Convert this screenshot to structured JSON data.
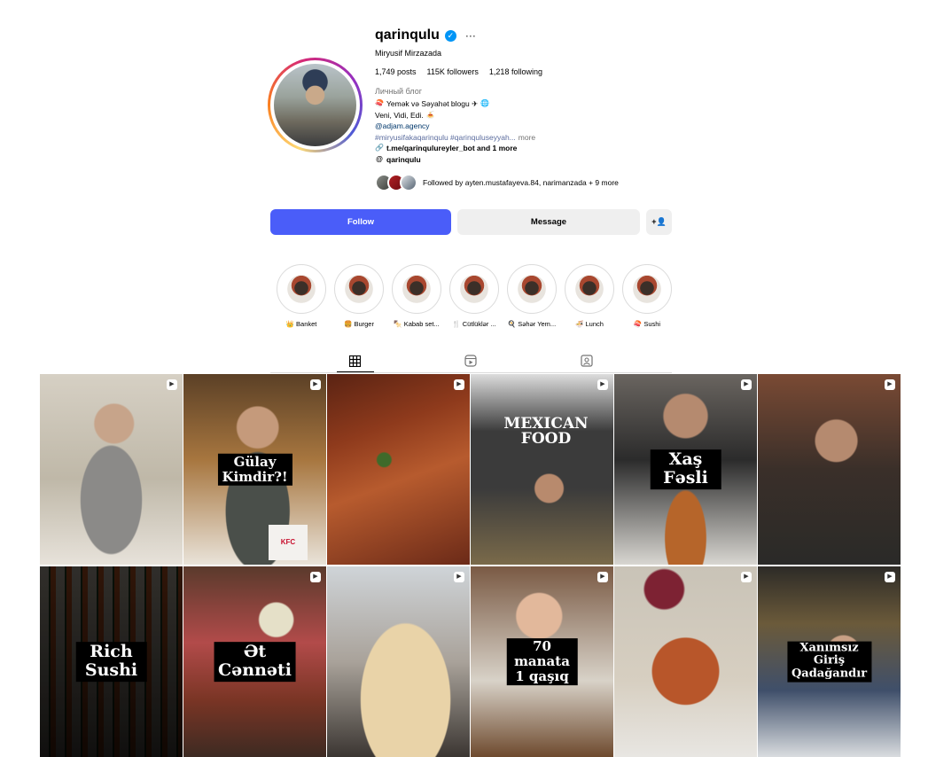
{
  "profile": {
    "username": "qarinqulu",
    "full_name": "Miryusif Mirzazada",
    "stats": {
      "posts": "1,749 posts",
      "followers": "115K followers",
      "following": "1,218 following"
    },
    "category": "Личный блог",
    "bio": {
      "line1": "Yemək və Səyahət blogu ✈",
      "line2": "Veni, Vidi, Edi.",
      "mention": "@adjam.agency",
      "hashtags": "#miryusifakaqarinqulu #qarinquluseyyah...",
      "more": "more",
      "link": "t.me/qarinqulureyler_bot and 1 more",
      "threads": "qarinqulu"
    },
    "followed_by": "Followed by ayten.mustafayeva.84, narimanzada + 9 more"
  },
  "actions": {
    "follow": "Follow",
    "message": "Message",
    "suggest_icon": "add-person-icon"
  },
  "highlights": [
    {
      "label": "👑 Banket"
    },
    {
      "label": "🍔 Burger"
    },
    {
      "label": "🍢 Kabab set..."
    },
    {
      "label": "🍴 Cütlüklər ..."
    },
    {
      "label": "🍳 Səhər Yem..."
    },
    {
      "label": "🍜 Lunch"
    },
    {
      "label": "🍣 Sushi"
    }
  ],
  "tabs": {
    "posts_icon": "grid-icon",
    "reels_icon": "reels-icon",
    "tagged_icon": "tagged-icon"
  },
  "posts": [
    {
      "caption": ""
    },
    {
      "caption": "Gülay Kimdir?!"
    },
    {
      "caption": ""
    },
    {
      "caption": ""
    },
    {
      "caption": "Xaş Fəsli"
    },
    {
      "caption": ""
    },
    {
      "caption": "Rich Sushi"
    },
    {
      "caption": "Ət Cənnəti"
    },
    {
      "caption": ""
    },
    {
      "caption": "70 manata 1 qaşıq"
    },
    {
      "caption": ""
    },
    {
      "caption": "Xanımsız Giriş Qadağandır"
    }
  ],
  "tile_image_texts": {
    "mexican_sign": "MEXICAN FOOD",
    "kfc": "KFC"
  },
  "colors": {
    "follow_button": "#4a5df9",
    "secondary_button": "#efefef",
    "verified": "#0095f6"
  }
}
